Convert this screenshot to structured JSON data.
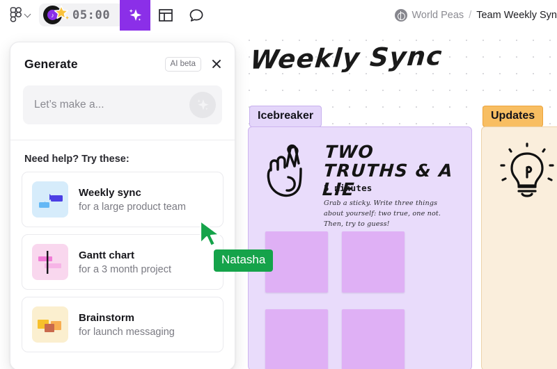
{
  "topbar": {
    "logo_icon": "figjam-logo-icon",
    "menu_chevron_icon": "chevron-down-icon",
    "timer": {
      "value": "05:00",
      "record_icon": "vinyl-record-icon",
      "note_glyph": "♪",
      "star_icon": "star-icon"
    },
    "tools": [
      {
        "name": "ai-generate",
        "icon": "sparkle-icon",
        "active": true
      },
      {
        "name": "template",
        "icon": "template-grid-icon",
        "active": false
      },
      {
        "name": "comment",
        "icon": "comment-bubble-icon",
        "active": false
      }
    ],
    "breadcrumb": {
      "team_icon": "team-avatar-icon",
      "team": "World Peas",
      "separator": "/",
      "file": "Team Weekly Syn"
    }
  },
  "panel": {
    "title": "Generate",
    "badge": "AI beta",
    "close_icon": "close-icon",
    "prompt": {
      "placeholder": "Let’s make a...",
      "value": "",
      "submit_icon": "sparkle-icon"
    },
    "help_label": "Need help? Try these:",
    "suggestions": [
      {
        "title": "Weekly sync",
        "subtitle": "for a large product team",
        "thumb": "weekly-sync-thumbnail"
      },
      {
        "title": "Gantt chart",
        "subtitle": "for a 3 month project",
        "thumb": "gantt-chart-thumbnail"
      },
      {
        "title": "Brainstorm",
        "subtitle": "for launch messaging",
        "thumb": "brainstorm-thumbnail"
      }
    ]
  },
  "cursor": {
    "label": "Natasha",
    "color": "#15A34A"
  },
  "canvas": {
    "title": "Weekly Sync",
    "sections": [
      {
        "pill": "Icebreaker",
        "pill_color": "#E4D6FA",
        "card": {
          "icon": "crossed-fingers-icon",
          "title": "TWO TRUTHS & A LIE",
          "duration": "5 minutes",
          "body": "Grab a sticky. Write three things about yourself: two true, one not. Then, try to guess!"
        },
        "sticky_color": "#DFB0F5",
        "sticky_count": 4
      },
      {
        "pill": "Updates",
        "pill_color": "#F8BE62",
        "card": {
          "icon": "lightbulb-icon"
        },
        "sticky_color": "#F8B75B",
        "sticky_count": 2
      }
    ]
  },
  "colors": {
    "accent_purple": "#8B2FE8",
    "cursor_green": "#15A34A",
    "icebreaker_board": "#E9DCFB",
    "updates_board": "#FAEEDC"
  }
}
